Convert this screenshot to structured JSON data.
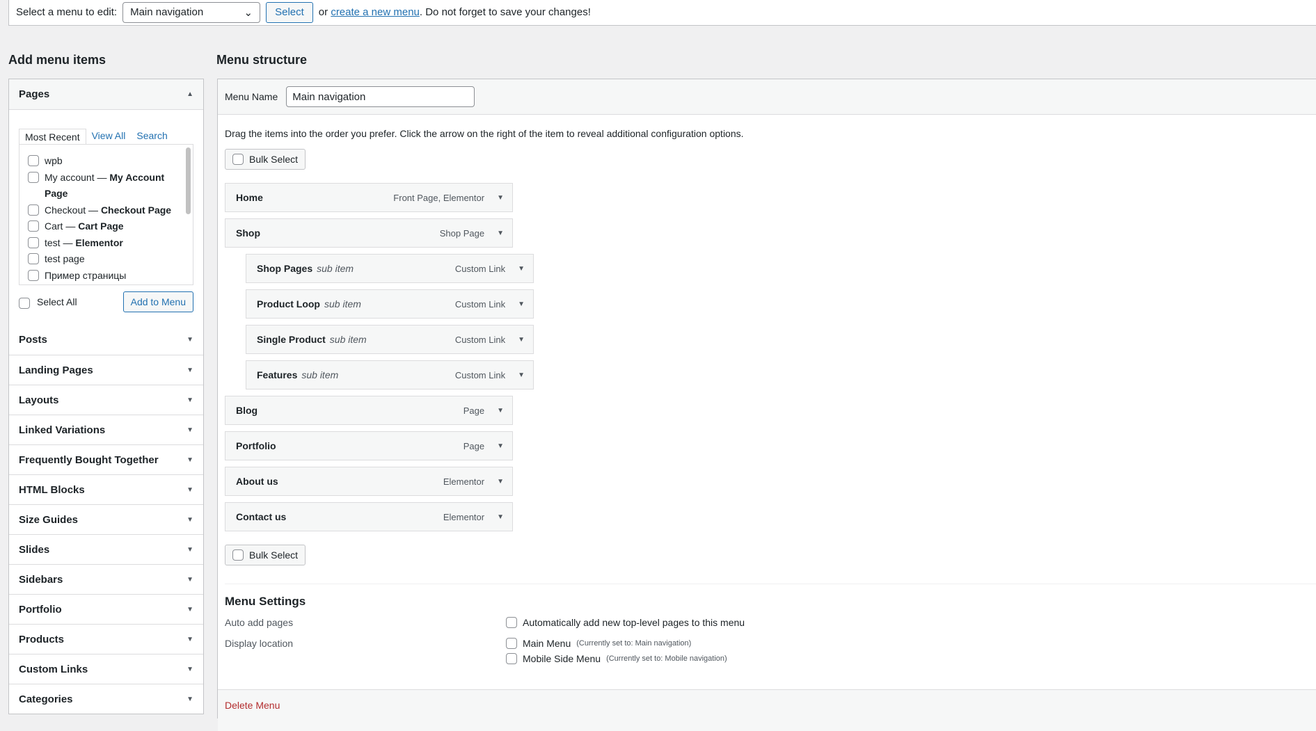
{
  "topbar": {
    "label": "Select a menu to edit:",
    "selected": "Main navigation",
    "select_button": "Select",
    "or": "or",
    "create_link": "create a new menu",
    "suffix": ". Do not forget to save your changes!"
  },
  "left": {
    "heading": "Add menu items",
    "pages": {
      "title": "Pages",
      "tabs": [
        "Most Recent",
        "View All",
        "Search"
      ],
      "items": [
        {
          "name": "wpb",
          "tag": ""
        },
        {
          "name": "My account — ",
          "tag": "My Account Page"
        },
        {
          "name": "Checkout — ",
          "tag": "Checkout Page"
        },
        {
          "name": "Cart — ",
          "tag": "Cart Page"
        },
        {
          "name": "test — ",
          "tag": "Elementor"
        },
        {
          "name": "test page",
          "tag": ""
        },
        {
          "name": "Пример страницы",
          "tag": ""
        }
      ],
      "select_all": "Select All",
      "add_button": "Add to Menu"
    },
    "sections": [
      "Posts",
      "Landing Pages",
      "Layouts",
      "Linked Variations",
      "Frequently Bought Together",
      "HTML Blocks",
      "Size Guides",
      "Slides",
      "Sidebars",
      "Portfolio",
      "Products",
      "Custom Links",
      "Categories"
    ]
  },
  "right": {
    "heading": "Menu structure",
    "menu_name_label": "Menu Name",
    "menu_name_value": "Main navigation",
    "instructions": "Drag the items into the order you prefer. Click the arrow on the right of the item to reveal additional configuration options.",
    "bulk_select": "Bulk Select",
    "items": [
      {
        "title": "Home",
        "type": "Front Page, Elementor",
        "sub": false
      },
      {
        "title": "Shop",
        "type": "Shop Page",
        "sub": false
      },
      {
        "title": "Shop Pages",
        "type": "Custom Link",
        "sub": true
      },
      {
        "title": "Product Loop",
        "type": "Custom Link",
        "sub": true
      },
      {
        "title": "Single Product",
        "type": "Custom Link",
        "sub": true
      },
      {
        "title": "Features",
        "type": "Custom Link",
        "sub": true
      },
      {
        "title": "Blog",
        "type": "Page",
        "sub": false
      },
      {
        "title": "Portfolio",
        "type": "Page",
        "sub": false
      },
      {
        "title": "About us",
        "type": "Elementor",
        "sub": false
      },
      {
        "title": "Contact us",
        "type": "Elementor",
        "sub": false
      }
    ],
    "sub_item_label": "sub item",
    "settings": {
      "title": "Menu Settings",
      "auto_add_label": "Auto add pages",
      "auto_add_option": "Automatically add new top-level pages to this menu",
      "display_label": "Display location",
      "locations": [
        {
          "name": "Main Menu",
          "note": "(Currently set to: Main navigation)"
        },
        {
          "name": "Mobile Side Menu",
          "note": "(Currently set to: Mobile navigation)"
        }
      ]
    },
    "delete": "Delete Menu"
  },
  "colors": {
    "accent": "#2271b1",
    "danger": "#b32d2e",
    "background": "#f0f0f1"
  }
}
